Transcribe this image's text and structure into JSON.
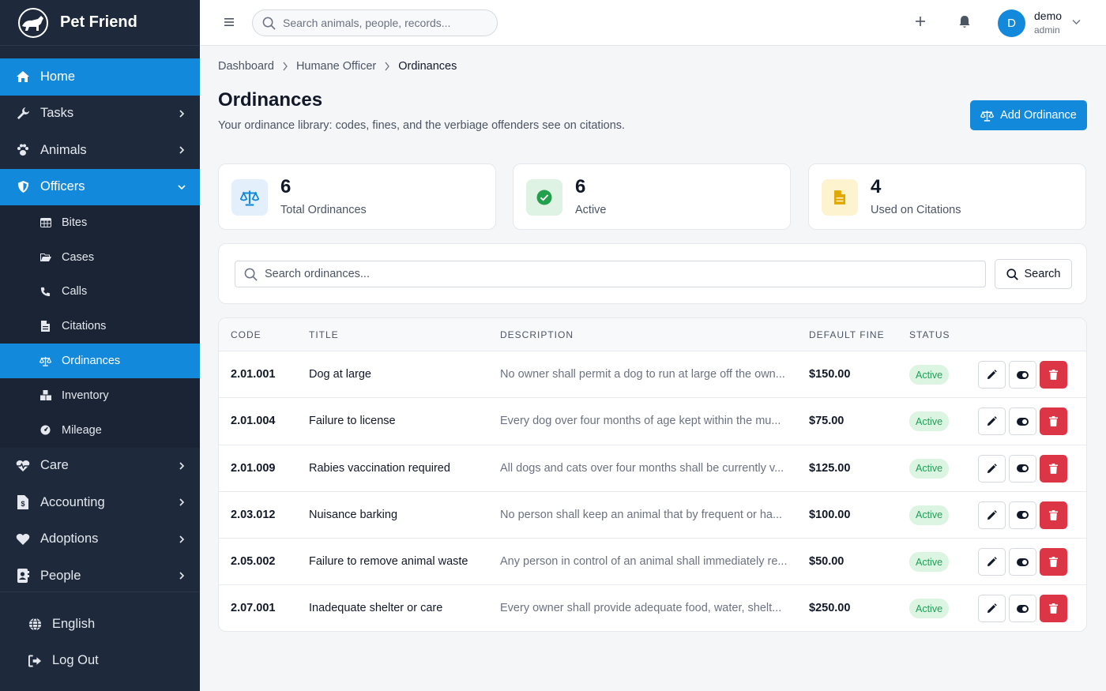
{
  "brand": {
    "name": "Pet Friend"
  },
  "sidebar": {
    "items": [
      {
        "label": "Home",
        "icon": "home-icon"
      },
      {
        "label": "Tasks",
        "icon": "wrench-icon"
      },
      {
        "label": "Animals",
        "icon": "paw-icon"
      },
      {
        "label": "Officers",
        "icon": "shield-icon"
      }
    ],
    "officers_sub": [
      {
        "label": "Bites",
        "icon": "table-icon"
      },
      {
        "label": "Cases",
        "icon": "folder-icon"
      },
      {
        "label": "Calls",
        "icon": "phone-icon"
      },
      {
        "label": "Citations",
        "icon": "file-icon"
      },
      {
        "label": "Ordinances",
        "icon": "scale-icon"
      },
      {
        "label": "Inventory",
        "icon": "boxes-icon"
      },
      {
        "label": "Mileage",
        "icon": "gauge-icon"
      }
    ],
    "items2": [
      {
        "label": "Care",
        "icon": "heart-pulse-icon"
      },
      {
        "label": "Accounting",
        "icon": "invoice-icon"
      },
      {
        "label": "Adoptions",
        "icon": "heart-icon"
      },
      {
        "label": "People",
        "icon": "contact-icon"
      }
    ],
    "footer": [
      {
        "label": "English",
        "icon": "globe-icon"
      },
      {
        "label": "Log Out",
        "icon": "logout-icon"
      }
    ]
  },
  "topbar": {
    "search_placeholder": "Search animals, people, records...",
    "user_initial": "D",
    "user_name": "demo",
    "user_role": "admin"
  },
  "breadcrumb": [
    "Dashboard",
    "Humane Officer",
    "Ordinances"
  ],
  "page": {
    "title": "Ordinances",
    "subtitle": "Your ordinance library: codes, fines, and the verbiage offenders see on citations.",
    "add_label": "Add Ordinance"
  },
  "stats": [
    {
      "value": "6",
      "label": "Total Ordinances",
      "icon": "scale-icon",
      "color": "#1389dc"
    },
    {
      "value": "6",
      "label": "Active",
      "icon": "check-circle-icon",
      "color": "#22a04b"
    },
    {
      "value": "4",
      "label": "Used on Citations",
      "icon": "file-icon",
      "color": "#e0a800"
    }
  ],
  "filter": {
    "placeholder": "Search ordinances...",
    "button": "Search"
  },
  "table": {
    "headers": [
      "CODE",
      "TITLE",
      "DESCRIPTION",
      "DEFAULT FINE",
      "STATUS"
    ],
    "rows": [
      {
        "code": "2.01.001",
        "title": "Dog at large",
        "description": "No owner shall permit a dog to run at large off the own...",
        "fine": "$150.00",
        "status": "Active"
      },
      {
        "code": "2.01.004",
        "title": "Failure to license",
        "description": "Every dog over four months of age kept within the mu...",
        "fine": "$75.00",
        "status": "Active"
      },
      {
        "code": "2.01.009",
        "title": "Rabies vaccination required",
        "description": "All dogs and cats over four months shall be currently v...",
        "fine": "$125.00",
        "status": "Active"
      },
      {
        "code": "2.03.012",
        "title": "Nuisance barking",
        "description": "No person shall keep an animal that by frequent or ha...",
        "fine": "$100.00",
        "status": "Active"
      },
      {
        "code": "2.05.002",
        "title": "Failure to remove animal waste",
        "description": "Any person in control of an animal shall immediately re...",
        "fine": "$50.00",
        "status": "Active"
      },
      {
        "code": "2.07.001",
        "title": "Inadequate shelter or care",
        "description": "Every owner shall provide adequate food, water, shelt...",
        "fine": "$250.00",
        "status": "Active"
      }
    ]
  },
  "colors": {
    "accent": "#1389dc",
    "sidebar": "#1e2a3b",
    "danger": "#dc3545",
    "success": "#1f9d55"
  }
}
